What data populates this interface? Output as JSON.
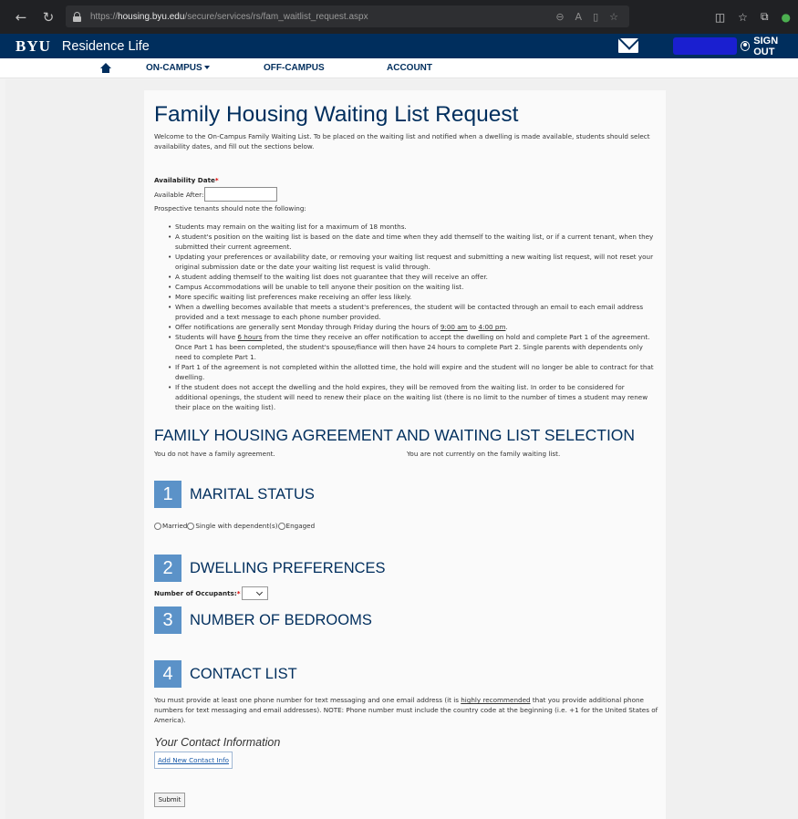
{
  "browser": {
    "url_prefix": "https://",
    "url_host": "housing.byu.edu",
    "url_path": "/secure/services/rs/fam_waitlist_request.aspx"
  },
  "header": {
    "logo": "BYU",
    "site_name": "Residence Life",
    "signout_label": "SIGN OUT"
  },
  "nav": {
    "items": [
      "ON-CAMPUS",
      "OFF-CAMPUS",
      "ACCOUNT"
    ]
  },
  "page": {
    "title": "Family Housing Waiting List Request",
    "intro": "Welcome to the On-Campus Family Waiting List. To be placed on the waiting list and notified when a dwelling is made available, students should select availability dates, and fill out the sections below.",
    "availability_label": "Availability Date",
    "required_mark": "*",
    "available_after_label": "Available After:",
    "available_after_value": "",
    "prospective_note": "Prospective tenants should note the following:",
    "rules": [
      "Students may remain on the waiting list for a maximum of 18 months.",
      "A student's position on the waiting list is based on the date and time when they add themself to the waiting list, or if a current tenant, when they submitted their current agreement.",
      "Updating your preferences or availability date, or removing your waiting list request and submitting a new waiting list request, will not reset your original submission date or the date your waiting list request is valid through.",
      "A student adding themself to the waiting list does not guarantee that they will receive an offer.",
      "Campus Accommodations will be unable to tell anyone their position on the waiting list.",
      "More specific waiting list preferences make receiving an offer less likely.",
      "When a dwelling becomes available that meets a student's preferences, the student will be contacted through an email to each email address provided and a text message to each phone number provided."
    ],
    "rule_offer": {
      "pre": "Offer notifications are generally sent Monday through Friday during the hours of ",
      "start": "9:00 am",
      "mid": " to ",
      "end": "4:00 pm",
      "post": "."
    },
    "rule_hours": {
      "pre": "Students will have ",
      "hours": "6 hours",
      "post": " from the time they receive an offer notification to accept the dwelling on hold and complete Part 1 of the agreement. Once Part 1 has been completed, the student's spouse/fiance will then have 24 hours to complete Part 2. Single parents with dependents only need to complete Part 1."
    },
    "rules_after": [
      "If Part 1 of the agreement is not completed within the allotted time, the hold will expire and the student will no longer be able to contract for that dwelling.",
      "If the student does not accept the dwelling and the hold expires, they will be removed from the waiting list. In order to be considered for additional openings, the student will need to renew their place on the waiting list (there is no limit to the number of times a student may renew their place on the waiting list)."
    ],
    "agreement_heading": "FAMILY HOUSING AGREEMENT AND WAITING LIST SELECTION",
    "agreement_status": "You do not have a family agreement.",
    "waitlist_status": "You are not currently on the family waiting list.",
    "steps": [
      {
        "num": "1",
        "title": "MARITAL STATUS"
      },
      {
        "num": "2",
        "title": "DWELLING PREFERENCES"
      },
      {
        "num": "3",
        "title": "NUMBER OF BEDROOMS"
      },
      {
        "num": "4",
        "title": "CONTACT LIST"
      }
    ],
    "marital_options": [
      "Married",
      "Single with dependent(s)",
      "Engaged"
    ],
    "occupants_label": "Number of Occupants:",
    "occupants_value": "",
    "contact_text": {
      "pre": "You must provide at least one phone number for text messaging and one email address (it is ",
      "emph": "highly recommended",
      "post": " that you provide additional phone numbers for text messaging and email addresses). NOTE: Phone number must include the country code at the beginning (i.e. +1 for the United States of America)."
    },
    "your_contact_heading": "Your Contact Information",
    "add_contact_label": "Add New Contact Info",
    "submit_label": "Submit"
  }
}
